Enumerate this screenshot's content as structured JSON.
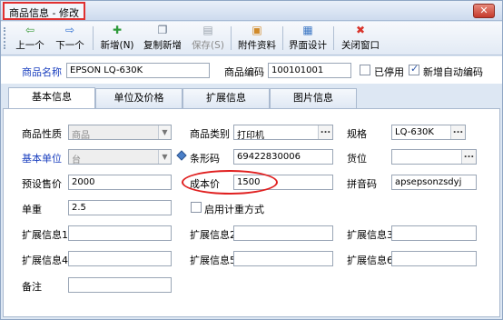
{
  "window": {
    "title": "商品信息 - 修改",
    "close_glyph": "✕"
  },
  "toolbar": {
    "buttons": [
      {
        "label": "上一个",
        "icon": "left-arrow-icon",
        "glyph": "⇦"
      },
      {
        "label": "下一个",
        "icon": "right-arrow-icon",
        "glyph": "⇨"
      },
      {
        "label": "新增(N)",
        "icon": "add-icon",
        "glyph": "✚"
      },
      {
        "label": "复制新增",
        "icon": "copy-icon",
        "glyph": "❐"
      },
      {
        "label": "保存(S)",
        "icon": "save-icon",
        "glyph": "▤"
      },
      {
        "label": "附件资料",
        "icon": "attachment-icon",
        "glyph": "▣"
      },
      {
        "label": "界面设计",
        "icon": "design-icon",
        "glyph": "▦"
      },
      {
        "label": "关闭窗口",
        "icon": "close-window-icon",
        "glyph": "✖"
      }
    ]
  },
  "header": {
    "name_label": "商品名称",
    "name_value": "EPSON LQ-630K",
    "code_label": "商品编码",
    "code_value": "100101001",
    "disabled_label": "已停用",
    "disabled_checked": false,
    "autocode_label": "新增自动编码",
    "autocode_checked": true
  },
  "tabs": [
    "基本信息",
    "单位及价格",
    "扩展信息",
    "图片信息"
  ],
  "form": {
    "nature_label": "商品性质",
    "nature_value": "商品",
    "category_label": "商品类别",
    "category_value": "打印机",
    "spec_label": "规格",
    "spec_value": "LQ-630K",
    "unit_label": "基本单位",
    "unit_value": "台",
    "barcode_label": "条形码",
    "barcode_value": "69422830006",
    "location_label": "货位",
    "location_value": "",
    "preset_price_label": "预设售价",
    "preset_price_value": "2000",
    "cost_label": "成本价",
    "cost_value": "1500",
    "pinyin_label": "拼音码",
    "pinyin_value": "apsepsonzsdyj",
    "weight_label": "单重",
    "weight_value": "2.5",
    "weigh_mode_label": "启用计重方式",
    "ext1_label": "扩展信息1",
    "ext2_label": "扩展信息2",
    "ext3_label": "扩展信息3",
    "ext4_label": "扩展信息4",
    "ext5_label": "扩展信息5",
    "ext6_label": "扩展信息6",
    "remark_label": "备注",
    "dots_glyph": "...",
    "dropdown_glyph": "▼"
  },
  "colors": {
    "annotation": "#e02020",
    "label_blue": "#1a3fbf"
  }
}
